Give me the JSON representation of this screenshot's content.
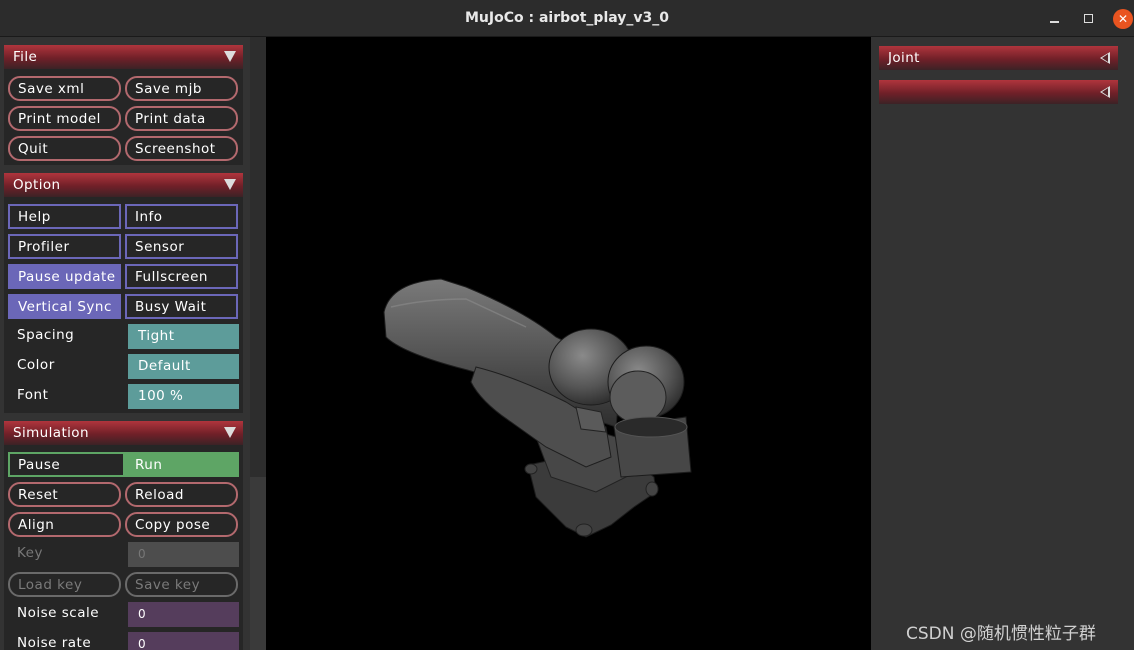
{
  "window": {
    "title": "MuJoCo : airbot_play_v3_0"
  },
  "file": {
    "header": "File",
    "save_xml": "Save xml",
    "save_mjb": "Save mjb",
    "print_model": "Print model",
    "print_data": "Print data",
    "quit": "Quit",
    "screenshot": "Screenshot"
  },
  "option": {
    "header": "Option",
    "help": "Help",
    "info": "Info",
    "profiler": "Profiler",
    "sensor": "Sensor",
    "pause_update": "Pause update",
    "fullscreen": "Fullscreen",
    "vertical_sync": "Vertical Sync",
    "busy_wait": "Busy Wait",
    "spacing_label": "Spacing",
    "spacing_value": "Tight",
    "color_label": "Color",
    "color_value": "Default",
    "font_label": "Font",
    "font_value": "100 %"
  },
  "simulation": {
    "header": "Simulation",
    "pause": "Pause",
    "run": "Run",
    "reset": "Reset",
    "reload": "Reload",
    "align": "Align",
    "copy_pose": "Copy pose",
    "key_label": "Key",
    "key_value": "0",
    "load_key": "Load key",
    "save_key": "Save key",
    "noise_scale_label": "Noise scale",
    "noise_scale_value": "0",
    "noise_rate_label": "Noise rate",
    "noise_rate_value": "0"
  },
  "right": {
    "joint_header": "Joint",
    "control_header": ""
  },
  "watermark": "CSDN @随机惯性粒子群",
  "colors": {
    "section_header": "#8a2a30",
    "button_border": "#b3696e",
    "checkbox_active": "#6b67b8",
    "select_fill": "#5d9c9a",
    "radio_active": "#5ea565",
    "edit_purple": "#553d5c",
    "close_button": "#e95420"
  }
}
